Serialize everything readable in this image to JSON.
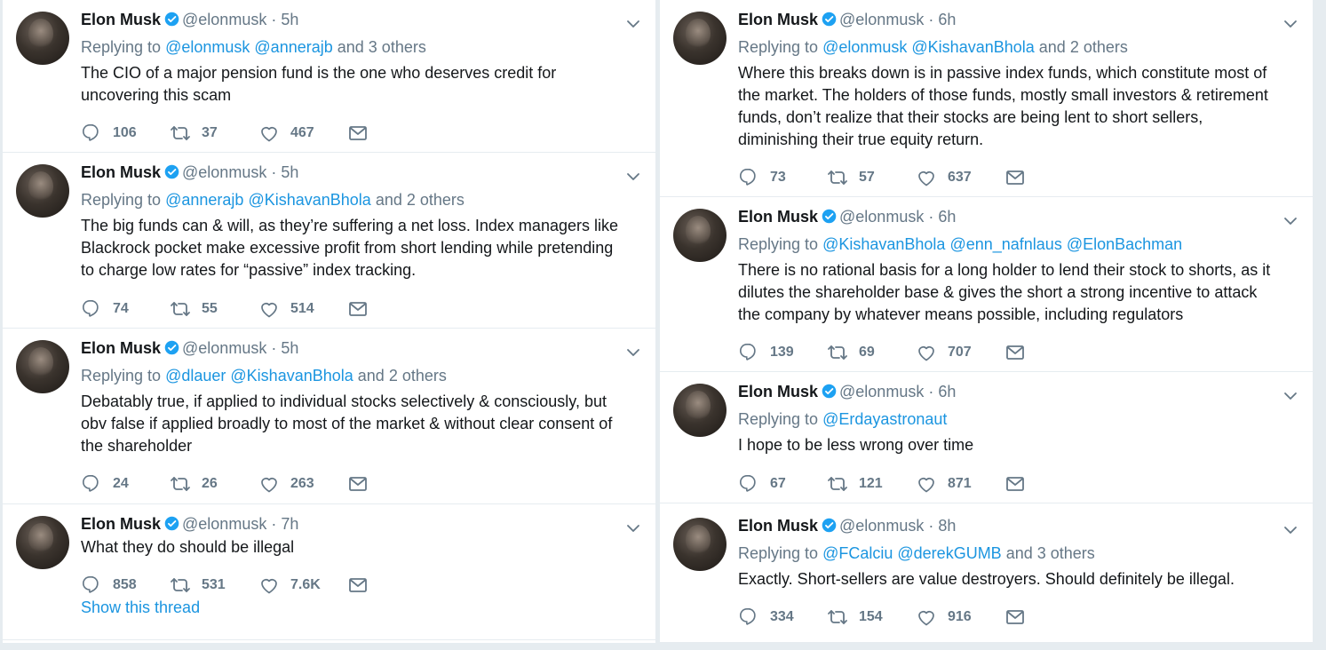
{
  "colors": {
    "link": "#1b95e0",
    "muted": "#657786",
    "text": "#14171a",
    "verified": "#1da1f2"
  },
  "icons": {
    "reply": "reply-icon",
    "retweet": "retweet-icon",
    "like": "heart-icon",
    "dm": "envelope-icon",
    "menu": "chevron-down-icon"
  },
  "tweets": [
    {
      "name": "Elon Musk",
      "handle": "@elonmusk",
      "dot": "·",
      "time": "5h",
      "reply": {
        "prefix": "Replying to",
        "mentions": [
          "@elonmusk",
          "@annerajb"
        ],
        "suffix": "and 3 others"
      },
      "text": "The CIO of a major pension fund is the one who deserves credit for uncovering this scam",
      "replies": "106",
      "retweets": "37",
      "likes": "467"
    },
    {
      "name": "Elon Musk",
      "handle": "@elonmusk",
      "dot": "·",
      "time": "5h",
      "reply": {
        "prefix": "Replying to",
        "mentions": [
          "@annerajb",
          "@KishavanBhola"
        ],
        "suffix": "and 2 others"
      },
      "text": "The big funds can & will, as they’re suffering a net loss. Index managers like Blackrock pocket make excessive profit from short lending while pretending to charge low rates for “passive” index tracking.",
      "replies": "74",
      "retweets": "55",
      "likes": "514"
    },
    {
      "name": "Elon Musk",
      "handle": "@elonmusk",
      "dot": "·",
      "time": "5h",
      "reply": {
        "prefix": "Replying to",
        "mentions": [
          "@dlauer",
          "@KishavanBhola"
        ],
        "suffix": "and 2 others"
      },
      "text": "Debatably true, if applied to individual stocks selectively & consciously, but obv false if applied broadly to most of the market & without clear consent of the shareholder",
      "replies": "24",
      "retweets": "26",
      "likes": "263"
    },
    {
      "name": "Elon Musk",
      "handle": "@elonmusk",
      "dot": "·",
      "time": "7h",
      "text": "What they do should be illegal",
      "replies": "858",
      "retweets": "531",
      "likes": "7.6K",
      "show_thread": "Show this thread"
    },
    {
      "name": "Elon Musk",
      "handle": "@elonmusk",
      "dot": "·",
      "time": "6h",
      "reply": {
        "prefix": "Replying to",
        "mentions": [
          "@elonmusk",
          "@KishavanBhola"
        ],
        "suffix": "and 2 others"
      },
      "text": "Where this breaks down is in passive index funds, which constitute most of the market. The holders of those funds, mostly small investors & retirement funds, don’t realize that their stocks are being lent to short sellers, diminishing their true equity return.",
      "replies": "73",
      "retweets": "57",
      "likes": "637"
    },
    {
      "name": "Elon Musk",
      "handle": "@elonmusk",
      "dot": "·",
      "time": "6h",
      "reply": {
        "prefix": "Replying to",
        "mentions": [
          "@KishavanBhola",
          "@enn_nafnlaus",
          "@ElonBachman"
        ],
        "suffix": ""
      },
      "text": "There is no rational basis for a long holder to lend their stock to shorts, as it dilutes the shareholder base & gives the short a strong incentive to attack the company by whatever means possible, including regulators",
      "replies": "139",
      "retweets": "69",
      "likes": "707"
    },
    {
      "name": "Elon Musk",
      "handle": "@elonmusk",
      "dot": "·",
      "time": "6h",
      "reply": {
        "prefix": "Replying to",
        "mentions": [
          "@Erdayastronaut"
        ],
        "suffix": ""
      },
      "text": "I hope to be less wrong over time",
      "replies": "67",
      "retweets": "121",
      "likes": "871"
    },
    {
      "name": "Elon Musk",
      "handle": "@elonmusk",
      "dot": "·",
      "time": "8h",
      "reply": {
        "prefix": "Replying to",
        "mentions": [
          "@FCalciu",
          "@derekGUMB"
        ],
        "suffix": "and 3 others"
      },
      "text": "Exactly. Short-sellers are value destroyers. Should definitely be illegal.",
      "replies": "334",
      "retweets": "154",
      "likes": "916"
    }
  ]
}
